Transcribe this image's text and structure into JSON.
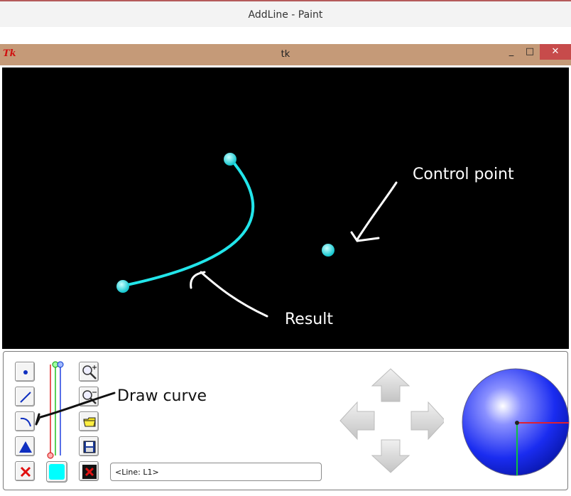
{
  "paint_window": {
    "title": "AddLine - Paint"
  },
  "tk_window": {
    "title": "tk",
    "logo": "Tk",
    "buttons": {
      "minimize": "_",
      "maximize": "□",
      "close": "✕"
    }
  },
  "annotations": {
    "control_point": "Control point",
    "result": "Result",
    "draw_curve": "Draw curve"
  },
  "toolbar": {
    "selection_field": "<Line: L1>",
    "tools": [
      {
        "name": "point-tool",
        "icon": "dot-icon"
      },
      {
        "name": "line-tool",
        "icon": "line-icon"
      },
      {
        "name": "curve-tool",
        "icon": "curve-icon"
      },
      {
        "name": "polygon-tool",
        "icon": "triangle-icon"
      },
      {
        "name": "delete-tool",
        "icon": "red-x-icon"
      },
      {
        "name": "zoom-in",
        "icon": "zoom-in-icon"
      },
      {
        "name": "zoom-out",
        "icon": "zoom-out-icon"
      },
      {
        "name": "open-file",
        "icon": "folder-icon"
      },
      {
        "name": "save-file",
        "icon": "floppy-icon"
      },
      {
        "name": "close-tool",
        "icon": "black-x-icon"
      }
    ],
    "current_color": "#00ffff",
    "slider_colors": [
      "#e02020",
      "#20c020",
      "#2040e0"
    ]
  },
  "colors": {
    "canvas_bg": "#000000",
    "curve": "#22e5ea",
    "control_point": "#22e5ea",
    "sphere": "#2030ff"
  }
}
